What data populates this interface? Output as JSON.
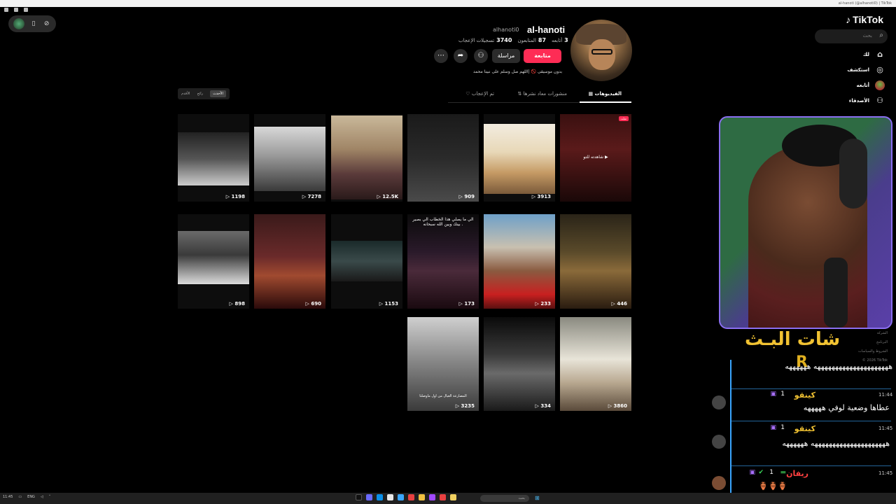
{
  "window": {
    "title": "al-hanoti (@alhanoti0) | TikTok"
  },
  "tiktok": {
    "logo": "TikTok",
    "search_placeholder": "بحث",
    "nav": [
      {
        "label": "لك",
        "icon": "home-icon"
      },
      {
        "label": "استكشف",
        "icon": "compass-icon"
      },
      {
        "label": "أتابعه",
        "icon": "following-avatar-icon"
      },
      {
        "label": "الأصدقاء",
        "icon": "friends-icon"
      }
    ],
    "profile": {
      "handle": "al-hanoti",
      "username": "alhanoti0",
      "following_count": "3",
      "following_label": "أتابعه",
      "followers_count": "87",
      "followers_label": "المتابعون",
      "likes_count": "3740",
      "likes_label": "تسجيلات الإعجاب",
      "follow_label": "متابعة",
      "message_label": "مراسلة",
      "bio": "بدون موسيقى 🚫 |اللهم صل وسلم على نبينا محمد"
    },
    "tabs": [
      {
        "label": "الفيديوهات",
        "icon": "grid-icon"
      },
      {
        "label": "منشورات معاد نشرها",
        "icon": "repost-icon"
      },
      {
        "label": "تم الإعجاب",
        "icon": "heart-icon"
      }
    ],
    "sort": [
      "الأحدث",
      "رائج",
      "الأقدم"
    ],
    "videos_row1": [
      {
        "views": "3913",
        "caption": ""
      },
      {
        "views": "909",
        "caption": ""
      },
      {
        "views": "12.5K",
        "caption": ""
      },
      {
        "views": "7278",
        "caption": ""
      },
      {
        "views": "1198",
        "caption": ""
      }
    ],
    "pinned_video": {
      "caption": "شاهدته للتو ▶",
      "badge": "مثبّت"
    },
    "videos_row2": [
      {
        "views": "446",
        "caption": ""
      },
      {
        "views": "233",
        "caption": ""
      },
      {
        "views": "173",
        "caption": "الي ما يصلي هذا الخطاب الي بصير بينك وبين الله سبحانه ."
      },
      {
        "views": "1153",
        "caption": ""
      },
      {
        "views": "690",
        "caption": ""
      },
      {
        "views": "898",
        "caption": ""
      }
    ],
    "videos_row3": [
      {
        "views": "3860",
        "caption": ""
      },
      {
        "views": "334",
        "caption": ""
      },
      {
        "views": "3235",
        "caption": "المصارعة العيال من اول ماوصلنا"
      }
    ],
    "footer": [
      "الشركة",
      "البرنامج",
      "الشروط والسياسات",
      "© 2026 TikTok"
    ]
  },
  "stream": {
    "chat_title": "شات البـث",
    "chat_logo": "R",
    "messages": [
      {
        "user": "",
        "time": "",
        "text": "هههههههههههههههههههههه ههههههه"
      },
      {
        "user": "كينقو",
        "badge": "1",
        "time": "11:44",
        "text": "عطاها وضعية لوفي هههههه"
      },
      {
        "user": "كينقو",
        "badge": "1",
        "time": "11:45",
        "text": "هههههههههههههههههههههه ههههههه"
      },
      {
        "user": "ريفان",
        "badge": "1",
        "time": "11:45",
        "text": "🏺🏺🏺"
      }
    ]
  },
  "taskbar": {
    "search_placeholder": "بحث",
    "lang": "ENG",
    "clock": "11:45"
  },
  "colors": {
    "accent": "#fe2c55",
    "chat_border": "#3aa6ff",
    "chat_title": "#f1c232",
    "cam_border": "#8a6ef0"
  }
}
